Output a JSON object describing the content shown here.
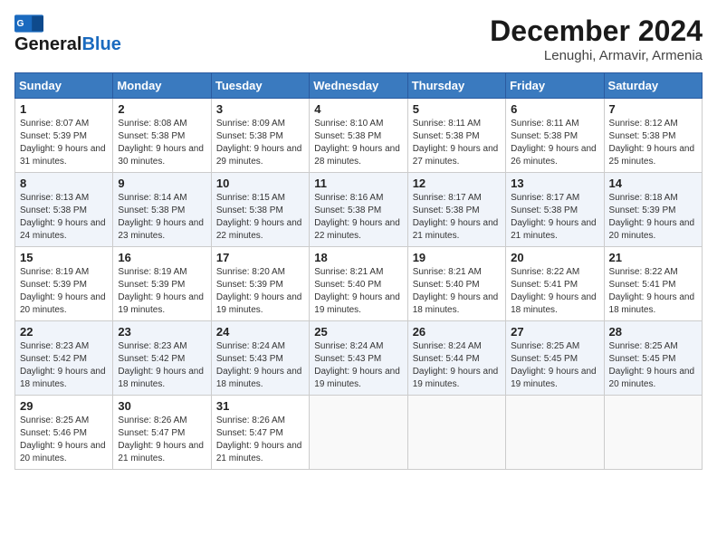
{
  "header": {
    "logo_line1": "General",
    "logo_line2": "Blue",
    "month": "December 2024",
    "location": "Lenughi, Armavir, Armenia"
  },
  "weekdays": [
    "Sunday",
    "Monday",
    "Tuesday",
    "Wednesday",
    "Thursday",
    "Friday",
    "Saturday"
  ],
  "weeks": [
    [
      {
        "day": 1,
        "sunrise": "8:07 AM",
        "sunset": "5:39 PM",
        "daylight": "9 hours and 31 minutes."
      },
      {
        "day": 2,
        "sunrise": "8:08 AM",
        "sunset": "5:38 PM",
        "daylight": "9 hours and 30 minutes."
      },
      {
        "day": 3,
        "sunrise": "8:09 AM",
        "sunset": "5:38 PM",
        "daylight": "9 hours and 29 minutes."
      },
      {
        "day": 4,
        "sunrise": "8:10 AM",
        "sunset": "5:38 PM",
        "daylight": "9 hours and 28 minutes."
      },
      {
        "day": 5,
        "sunrise": "8:11 AM",
        "sunset": "5:38 PM",
        "daylight": "9 hours and 27 minutes."
      },
      {
        "day": 6,
        "sunrise": "8:11 AM",
        "sunset": "5:38 PM",
        "daylight": "9 hours and 26 minutes."
      },
      {
        "day": 7,
        "sunrise": "8:12 AM",
        "sunset": "5:38 PM",
        "daylight": "9 hours and 25 minutes."
      }
    ],
    [
      {
        "day": 8,
        "sunrise": "8:13 AM",
        "sunset": "5:38 PM",
        "daylight": "9 hours and 24 minutes."
      },
      {
        "day": 9,
        "sunrise": "8:14 AM",
        "sunset": "5:38 PM",
        "daylight": "9 hours and 23 minutes."
      },
      {
        "day": 10,
        "sunrise": "8:15 AM",
        "sunset": "5:38 PM",
        "daylight": "9 hours and 22 minutes."
      },
      {
        "day": 11,
        "sunrise": "8:16 AM",
        "sunset": "5:38 PM",
        "daylight": "9 hours and 22 minutes."
      },
      {
        "day": 12,
        "sunrise": "8:17 AM",
        "sunset": "5:38 PM",
        "daylight": "9 hours and 21 minutes."
      },
      {
        "day": 13,
        "sunrise": "8:17 AM",
        "sunset": "5:38 PM",
        "daylight": "9 hours and 21 minutes."
      },
      {
        "day": 14,
        "sunrise": "8:18 AM",
        "sunset": "5:39 PM",
        "daylight": "9 hours and 20 minutes."
      }
    ],
    [
      {
        "day": 15,
        "sunrise": "8:19 AM",
        "sunset": "5:39 PM",
        "daylight": "9 hours and 20 minutes."
      },
      {
        "day": 16,
        "sunrise": "8:19 AM",
        "sunset": "5:39 PM",
        "daylight": "9 hours and 19 minutes."
      },
      {
        "day": 17,
        "sunrise": "8:20 AM",
        "sunset": "5:39 PM",
        "daylight": "9 hours and 19 minutes."
      },
      {
        "day": 18,
        "sunrise": "8:21 AM",
        "sunset": "5:40 PM",
        "daylight": "9 hours and 19 minutes."
      },
      {
        "day": 19,
        "sunrise": "8:21 AM",
        "sunset": "5:40 PM",
        "daylight": "9 hours and 18 minutes."
      },
      {
        "day": 20,
        "sunrise": "8:22 AM",
        "sunset": "5:41 PM",
        "daylight": "9 hours and 18 minutes."
      },
      {
        "day": 21,
        "sunrise": "8:22 AM",
        "sunset": "5:41 PM",
        "daylight": "9 hours and 18 minutes."
      }
    ],
    [
      {
        "day": 22,
        "sunrise": "8:23 AM",
        "sunset": "5:42 PM",
        "daylight": "9 hours and 18 minutes."
      },
      {
        "day": 23,
        "sunrise": "8:23 AM",
        "sunset": "5:42 PM",
        "daylight": "9 hours and 18 minutes."
      },
      {
        "day": 24,
        "sunrise": "8:24 AM",
        "sunset": "5:43 PM",
        "daylight": "9 hours and 18 minutes."
      },
      {
        "day": 25,
        "sunrise": "8:24 AM",
        "sunset": "5:43 PM",
        "daylight": "9 hours and 19 minutes."
      },
      {
        "day": 26,
        "sunrise": "8:24 AM",
        "sunset": "5:44 PM",
        "daylight": "9 hours and 19 minutes."
      },
      {
        "day": 27,
        "sunrise": "8:25 AM",
        "sunset": "5:45 PM",
        "daylight": "9 hours and 19 minutes."
      },
      {
        "day": 28,
        "sunrise": "8:25 AM",
        "sunset": "5:45 PM",
        "daylight": "9 hours and 20 minutes."
      }
    ],
    [
      {
        "day": 29,
        "sunrise": "8:25 AM",
        "sunset": "5:46 PM",
        "daylight": "9 hours and 20 minutes."
      },
      {
        "day": 30,
        "sunrise": "8:26 AM",
        "sunset": "5:47 PM",
        "daylight": "9 hours and 21 minutes."
      },
      {
        "day": 31,
        "sunrise": "8:26 AM",
        "sunset": "5:47 PM",
        "daylight": "9 hours and 21 minutes."
      },
      null,
      null,
      null,
      null
    ]
  ]
}
